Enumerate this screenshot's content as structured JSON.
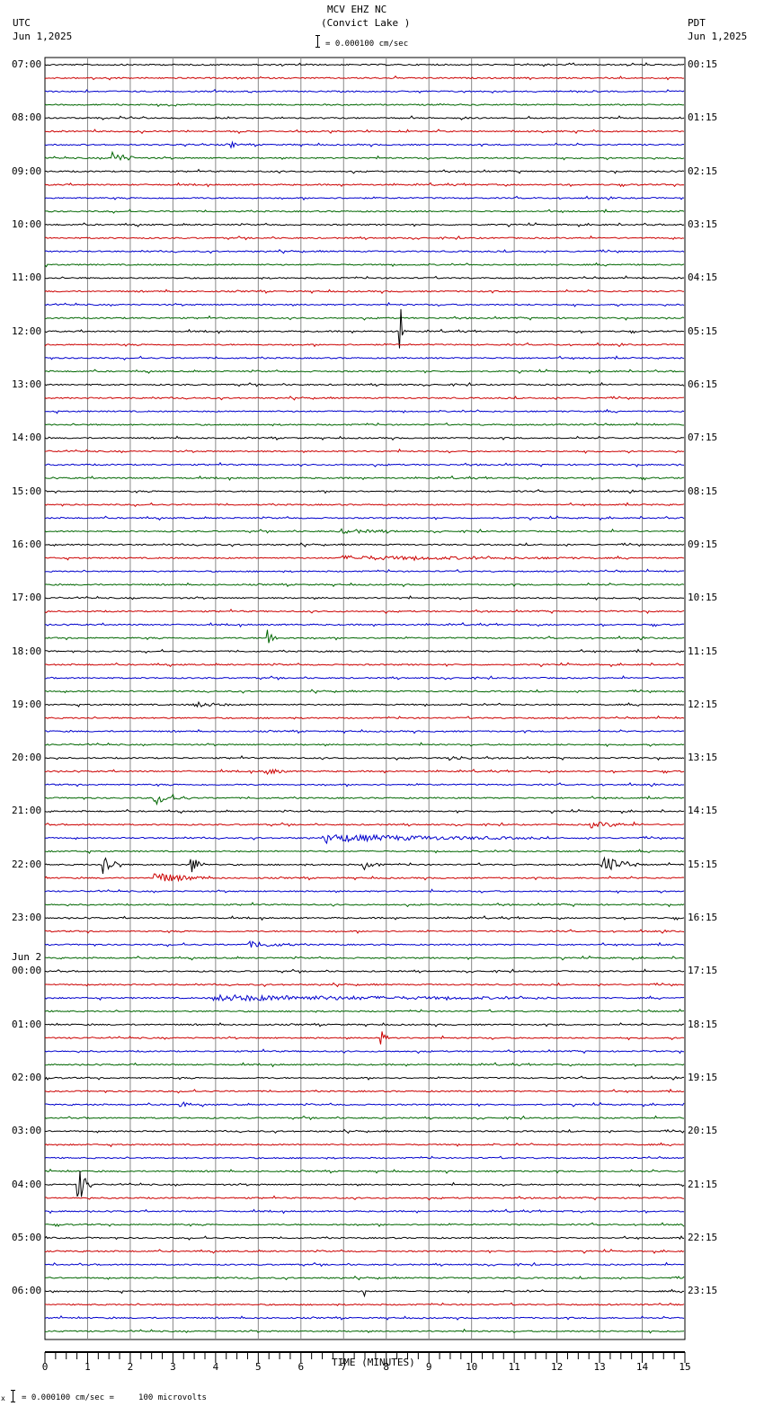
{
  "header": {
    "station": "MCV EHZ NC",
    "location": "(Convict Lake )",
    "left_tz": "UTC",
    "left_date": "Jun 1,2025",
    "right_tz": "PDT",
    "right_date": "Jun 1,2025",
    "scale": "= 0.000100 cm/sec"
  },
  "footer": {
    "scale_prefix": "x",
    "scale": "= 0.000100 cm/sec =     100 microvolts"
  },
  "chart_data": {
    "type": "line",
    "title": "MCV EHZ NC (Convict Lake )",
    "xlabel": "TIME (MINUTES)",
    "xlim": [
      0,
      15
    ],
    "x_ticks": [
      "0",
      "1",
      "2",
      "3",
      "4",
      "5",
      "6",
      "7",
      "8",
      "9",
      "10",
      "11",
      "12",
      "13",
      "14",
      "15"
    ],
    "traces_per_hour": 4,
    "trace_colors": [
      "#000000",
      "#cc0000",
      "#0000cc",
      "#006600"
    ],
    "left_labels": [
      "07:00",
      "08:00",
      "09:00",
      "10:00",
      "11:00",
      "12:00",
      "13:00",
      "14:00",
      "15:00",
      "16:00",
      "17:00",
      "18:00",
      "19:00",
      "20:00",
      "21:00",
      "22:00",
      "23:00",
      "00:00",
      "01:00",
      "02:00",
      "03:00",
      "04:00",
      "05:00",
      "06:00"
    ],
    "date_change_label": "Jun 2",
    "date_change_index": 17,
    "right_labels": [
      "00:15",
      "01:15",
      "02:15",
      "03:15",
      "04:15",
      "05:15",
      "06:15",
      "07:15",
      "08:15",
      "09:15",
      "10:15",
      "11:15",
      "12:15",
      "13:15",
      "14:15",
      "15:15",
      "16:15",
      "17:15",
      "18:15",
      "19:15",
      "20:15",
      "21:15",
      "22:15",
      "23:15"
    ],
    "events": [
      {
        "trace": 6,
        "minute": 4.4,
        "amp": 3,
        "dur": 0.1
      },
      {
        "trace": 7,
        "minute": 1.6,
        "amp": 7,
        "dur": 0.5
      },
      {
        "trace": 20,
        "minute": 8.35,
        "amp": 30,
        "dur": 0.05
      },
      {
        "trace": 35,
        "minute": 7.0,
        "amp": 2,
        "dur": 1.5
      },
      {
        "trace": 37,
        "minute": 7.0,
        "amp": 2,
        "dur": 6
      },
      {
        "trace": 43,
        "minute": 5.25,
        "amp": 10,
        "dur": 0.2
      },
      {
        "trace": 48,
        "minute": 3.5,
        "amp": 3,
        "dur": 0.9
      },
      {
        "trace": 52,
        "minute": 9.5,
        "amp": 3,
        "dur": 0.5
      },
      {
        "trace": 53,
        "minute": 5.2,
        "amp": 3.5,
        "dur": 0.5
      },
      {
        "trace": 55,
        "minute": 2.6,
        "amp": 6,
        "dur": 0.8
      },
      {
        "trace": 57,
        "minute": 12.8,
        "amp": 3,
        "dur": 1.2
      },
      {
        "trace": 58,
        "minute": 6.6,
        "amp": 4,
        "dur": 5
      },
      {
        "trace": 60,
        "minute": 1.4,
        "amp": 12,
        "dur": 0.4
      },
      {
        "trace": 60,
        "minute": 3.45,
        "amp": 9,
        "dur": 0.3
      },
      {
        "trace": 60,
        "minute": 7.5,
        "amp": 5,
        "dur": 0.4
      },
      {
        "trace": 60,
        "minute": 13.1,
        "amp": 9,
        "dur": 0.8
      },
      {
        "trace": 61,
        "minute": 2.6,
        "amp": 6,
        "dur": 1.2
      },
      {
        "trace": 66,
        "minute": 4.8,
        "amp": 3,
        "dur": 1.2
      },
      {
        "trace": 70,
        "minute": 4.0,
        "amp": 3,
        "dur": 8
      },
      {
        "trace": 73,
        "minute": 7.9,
        "amp": 7,
        "dur": 0.15
      },
      {
        "trace": 78,
        "minute": 3.2,
        "amp": 4,
        "dur": 0.15
      },
      {
        "trace": 84,
        "minute": 0.8,
        "amp": 18,
        "dur": 0.3
      },
      {
        "trace": 92,
        "minute": 7.5,
        "amp": 9,
        "dur": 0.05
      }
    ]
  }
}
